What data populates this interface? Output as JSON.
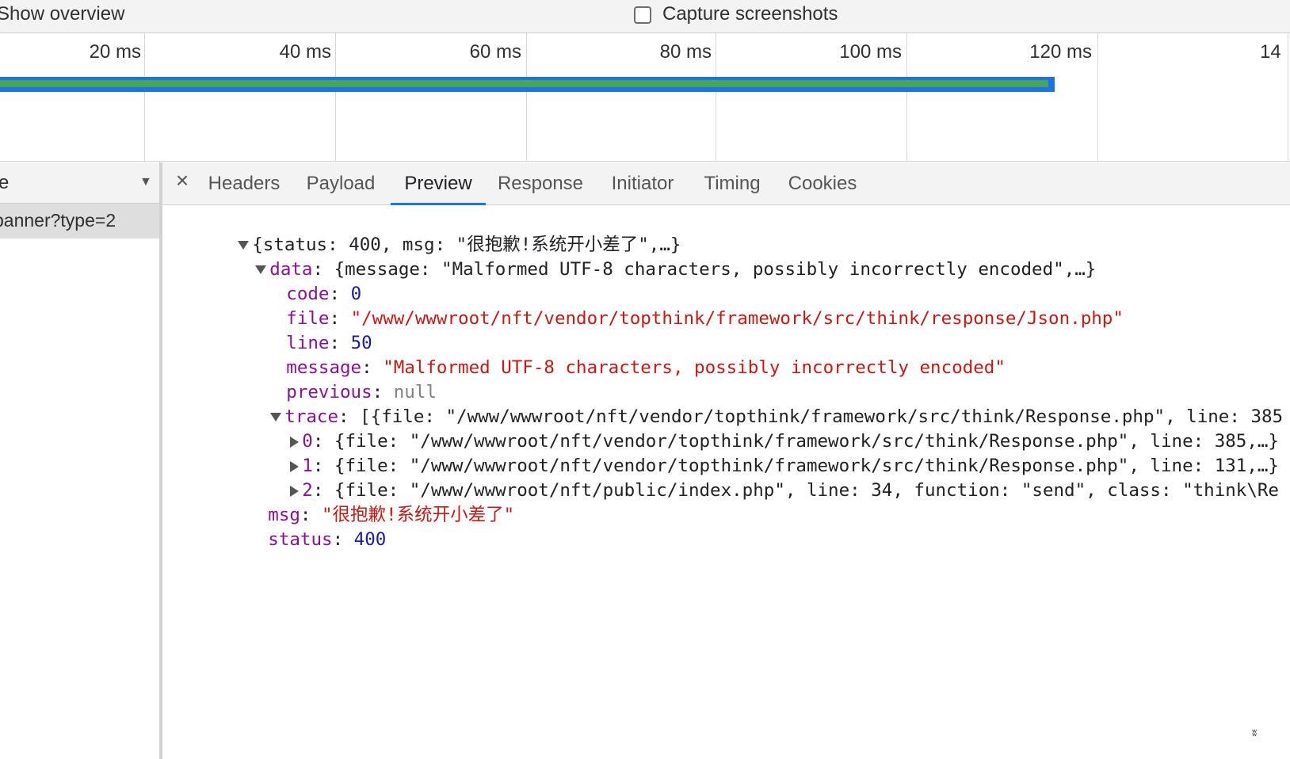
{
  "toolbar": {
    "show_overview_label": "Show overview",
    "capture_label": "Capture screenshots",
    "capture_checked": false
  },
  "timeline": {
    "ticks": [
      "20 ms",
      "40 ms",
      "60 ms",
      "80 ms",
      "100 ms",
      "120 ms",
      "14"
    ],
    "request_bar_end_ms": 115.5,
    "colors": {
      "bar_outline": "#1a73e8",
      "bar_fill": "#4aa556"
    }
  },
  "request_list": {
    "header_label": "e",
    "header_arrow": "▼",
    "selected_request": "banner?type=2"
  },
  "detail": {
    "close_glyph": "×",
    "tabs": [
      "Headers",
      "Payload",
      "Preview",
      "Response",
      "Initiator",
      "Timing",
      "Cookies"
    ],
    "active_tab": "Preview",
    "accent_color": "#1a73e8"
  },
  "preview": {
    "root_summary": "{status: 400, msg: \"很抱歉!系统开小差了\",…}",
    "data_key": "data",
    "data_summary": "{message: \"Malformed UTF-8 characters, possibly incorrectly encoded\",…}",
    "code_key": "code",
    "code_value": "0",
    "file_key": "file",
    "file_value": "\"/www/wwwroot/nft/vendor/topthink/framework/src/think/response/Json.php\"",
    "line_key": "line",
    "line_value": "50",
    "message_key": "message",
    "message_value": "\"Malformed UTF-8 characters, possibly incorrectly encoded\"",
    "previous_key": "previous",
    "previous_value": "null",
    "trace_key": "trace",
    "trace_summary": "[{file: \"/www/wwwroot/nft/vendor/topthink/framework/src/think/Response.php\", line: 385",
    "trace_items": [
      {
        "index": "0",
        "summary": "{file: \"/www/wwwroot/nft/vendor/topthink/framework/src/think/Response.php\", line: 385,…}"
      },
      {
        "index": "1",
        "summary": "{file: \"/www/wwwroot/nft/vendor/topthink/framework/src/think/Response.php\", line: 131,…}"
      },
      {
        "index": "2",
        "summary": "{file: \"/www/wwwroot/nft/public/index.php\", line: 34, function: \"send\", class: \"think\\Re"
      }
    ],
    "msg_key": "msg",
    "msg_value": "\"很抱歉!系统开小差了\"",
    "status_key": "status",
    "status_value": "400"
  }
}
